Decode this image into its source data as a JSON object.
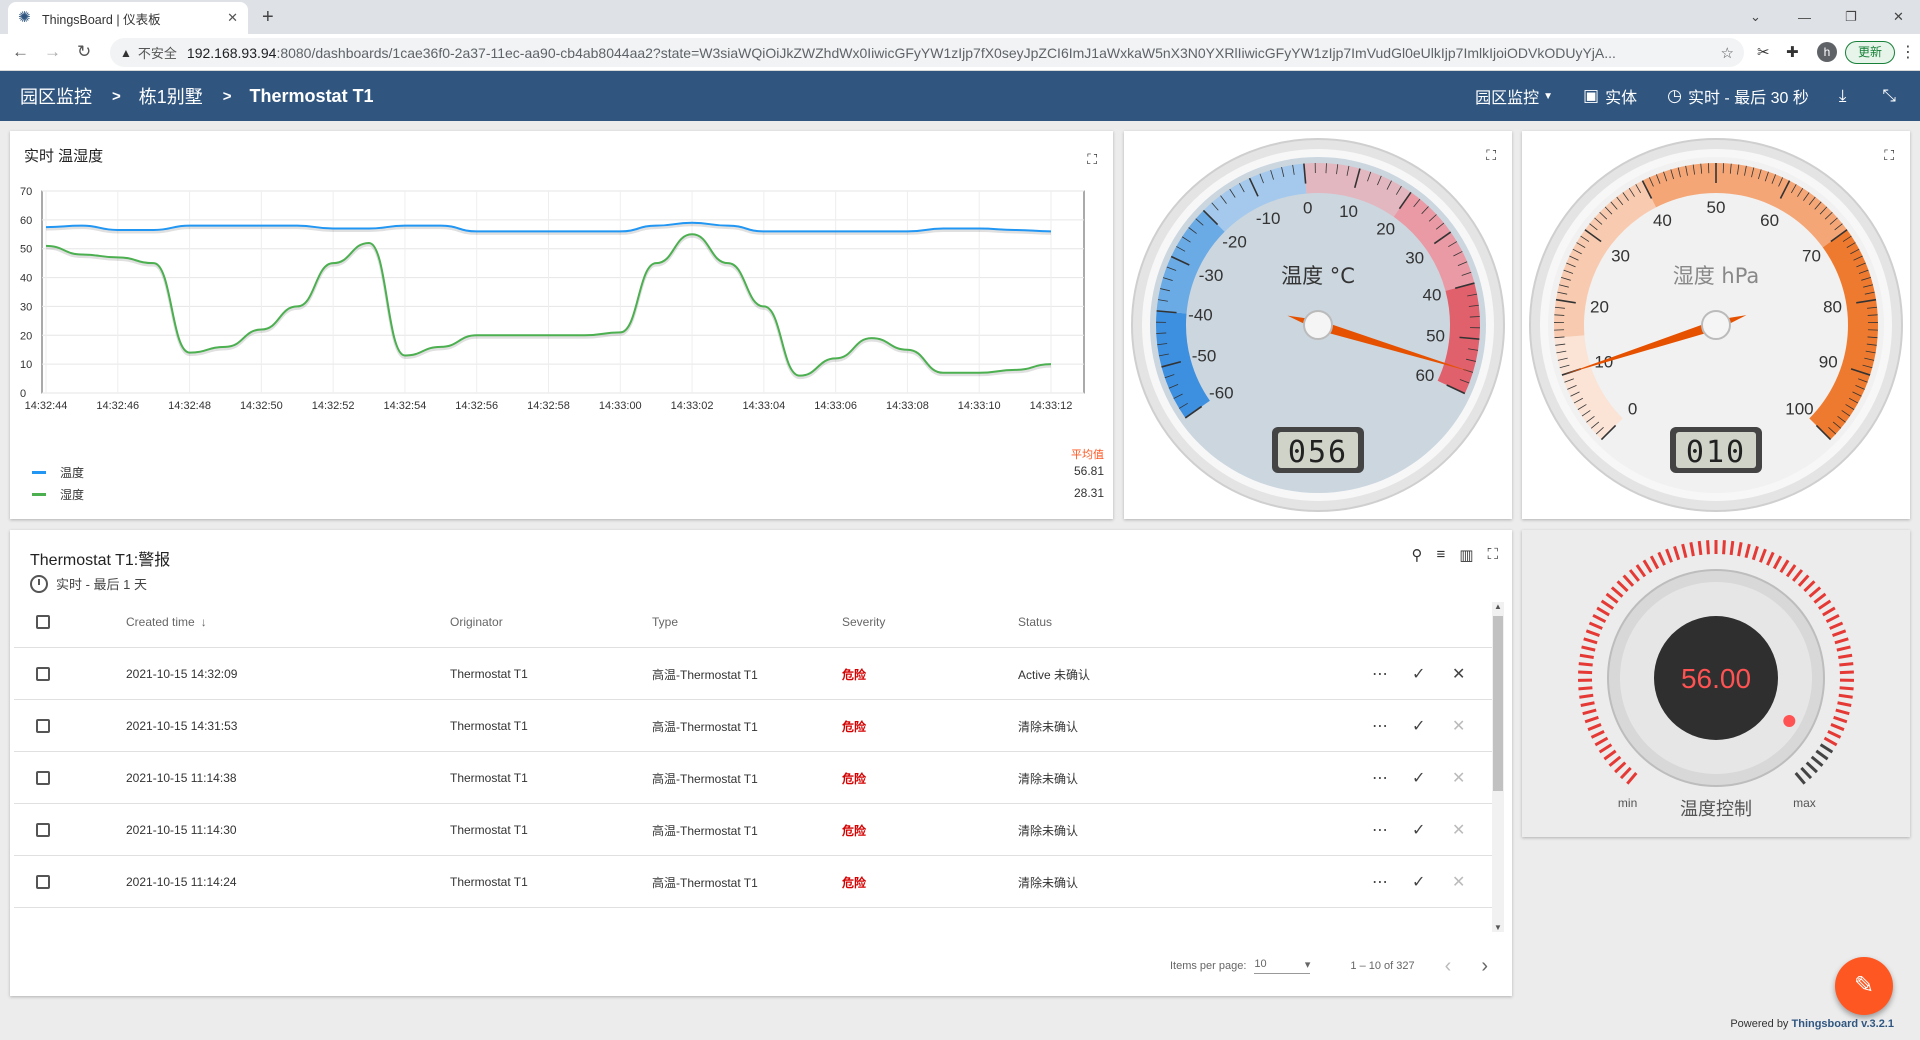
{
  "browser": {
    "tab_title": "ThingsBoard | 仪表板",
    "insecure_label": "不安全",
    "url_host": "192.168.93.94",
    "url_path": ":8080/dashboards/1cae36f0-2a37-11ec-aa90-cb4ab8044aa2?state=W3siaWQiOiJkZWZhdWx0IiwicGFyYW1zIjp7fX0seyJpZCI6ImJ1aWxkaW5nX3N0YXRlIiwicGFyYW1zIjp7ImVudGl0eUlkIjp7ImlkIjoiODVkODUyYjA...",
    "update_label": "更新",
    "profile_initial": "h"
  },
  "toolbar": {
    "crumbs": [
      "园区监控",
      "栋1别墅",
      "Thermostat T1"
    ],
    "dashboard_select": "园区监控",
    "entities_label": "实体",
    "timewindow_label": "实时 - 最后 30 秒"
  },
  "chart_widget": {
    "title": "实时 温湿度",
    "legend_header": "平均值"
  },
  "chart_data": {
    "type": "line",
    "title": "实时 温湿度",
    "x": [
      "14:32:44",
      "14:32:45",
      "14:32:46",
      "14:32:47",
      "14:32:48",
      "14:32:49",
      "14:32:50",
      "14:32:51",
      "14:32:52",
      "14:32:53",
      "14:32:54",
      "14:32:55",
      "14:32:56",
      "14:32:57",
      "14:32:58",
      "14:32:59",
      "14:33:00",
      "14:33:01",
      "14:33:02",
      "14:33:03",
      "14:33:04",
      "14:33:05",
      "14:33:06",
      "14:33:07",
      "14:33:08",
      "14:33:09",
      "14:33:10",
      "14:33:11",
      "14:33:12"
    ],
    "x_ticks": [
      "14:32:44",
      "14:32:46",
      "14:32:48",
      "14:32:50",
      "14:32:52",
      "14:32:54",
      "14:32:56",
      "14:32:58",
      "14:33:00",
      "14:33:02",
      "14:33:04",
      "14:33:06",
      "14:33:08",
      "14:33:10",
      "14:33:12"
    ],
    "ylim": [
      0,
      70
    ],
    "y_ticks": [
      0,
      10,
      20,
      30,
      40,
      50,
      60,
      70
    ],
    "grid": true,
    "series": [
      {
        "name": "温度",
        "color": "#2196f3",
        "avg": "56.81",
        "values": [
          57.5,
          58,
          56.5,
          56.5,
          58,
          58,
          58,
          58,
          57,
          57,
          58,
          58,
          56,
          56,
          56,
          56,
          56,
          58,
          59,
          58,
          56,
          56,
          56,
          56,
          56,
          57,
          57,
          56.5,
          56
        ]
      },
      {
        "name": "湿度",
        "color": "#4caf50",
        "avg": "28.31",
        "values": [
          51,
          48,
          47,
          45,
          14,
          16,
          22,
          30,
          45,
          52,
          13,
          16,
          20,
          20,
          20,
          20,
          21,
          45,
          55,
          45,
          30,
          6,
          12,
          19,
          15,
          7,
          7,
          8,
          10
        ]
      }
    ]
  },
  "gauge_temp": {
    "unit_label": "温度 °C",
    "min": -60,
    "max": 60,
    "value": 56,
    "display": "056",
    "ticks": [
      "-60",
      "-50",
      "-40",
      "-30",
      "-20",
      "-10",
      "0",
      "10",
      "20",
      "30",
      "40",
      "50",
      "60"
    ]
  },
  "gauge_hum": {
    "unit_label": "湿度 hPa",
    "min": 0,
    "max": 100,
    "value": 10,
    "display": "010",
    "ticks": [
      "0",
      "10",
      "20",
      "30",
      "40",
      "50",
      "60",
      "70",
      "80",
      "90",
      "100"
    ]
  },
  "knob": {
    "value": "56.00",
    "min_label": "min",
    "max_label": "max",
    "title": "温度控制",
    "level": 0.93
  },
  "alarms": {
    "title": "Thermostat T1:警报",
    "subtitle": "实时 - 最后 1 天",
    "columns": [
      "Created time",
      "Originator",
      "Type",
      "Severity",
      "Status"
    ],
    "rows": [
      {
        "time": "2021-10-15 14:32:09",
        "originator": "Thermostat T1",
        "type": "高温-Thermostat T1",
        "severity": "危险",
        "status": "Active 未确认"
      },
      {
        "time": "2021-10-15 14:31:53",
        "originator": "Thermostat T1",
        "type": "高温-Thermostat T1",
        "severity": "危险",
        "status": "清除未确认"
      },
      {
        "time": "2021-10-15 11:14:38",
        "originator": "Thermostat T1",
        "type": "高温-Thermostat T1",
        "severity": "危险",
        "status": "清除未确认"
      },
      {
        "time": "2021-10-15 11:14:30",
        "originator": "Thermostat T1",
        "type": "高温-Thermostat T1",
        "severity": "危险",
        "status": "清除未确认"
      },
      {
        "time": "2021-10-15 11:14:24",
        "originator": "Thermostat T1",
        "type": "高温-Thermostat T1",
        "severity": "危险",
        "status": "清除未确认"
      }
    ],
    "items_per_page_label": "Items per page:",
    "items_per_page": "10",
    "range": "1 – 10 of 327"
  },
  "footer": {
    "prefix": "Powered by",
    "brand": "Thingsboard v.3.2.1"
  },
  "colors": {
    "brand": "#305680",
    "accent": "#ff5722",
    "danger": "#d50000"
  }
}
